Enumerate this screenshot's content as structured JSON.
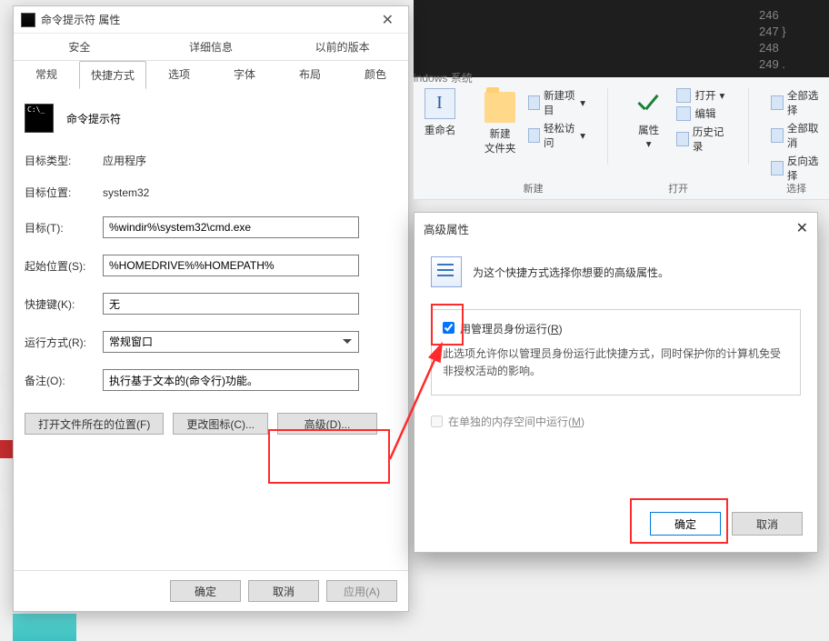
{
  "code_editor": {
    "lines": [
      "246",
      "247  }",
      "248",
      "249  ."
    ]
  },
  "props_dialog": {
    "title": "命令提示符 属性",
    "tabs_top": [
      "安全",
      "详细信息",
      "以前的版本"
    ],
    "tabs_bottom": [
      "常规",
      "快捷方式",
      "选项",
      "字体",
      "布局",
      "颜色"
    ],
    "active_tab": "快捷方式",
    "shortcut_name": "命令提示符",
    "rows": {
      "target_type_label": "目标类型:",
      "target_type_value": "应用程序",
      "target_loc_label": "目标位置:",
      "target_loc_value": "system32",
      "target_label": "目标(T):",
      "target_value": "%windir%\\system32\\cmd.exe",
      "start_in_label": "起始位置(S):",
      "start_in_value": "%HOMEDRIVE%%HOMEPATH%",
      "hotkey_label": "快捷键(K):",
      "hotkey_value": "无",
      "run_label": "运行方式(R):",
      "run_value": "常规窗口",
      "comment_label": "备注(O):",
      "comment_value": "执行基于文本的(命令行)功能。"
    },
    "buttons": {
      "open_location": "打开文件所在的位置(F)",
      "change_icon": "更改图标(C)...",
      "advanced": "高级(D)..."
    },
    "footer": {
      "ok": "确定",
      "cancel": "取消",
      "apply": "应用(A)"
    }
  },
  "ribbon": {
    "header": "indows 系统",
    "rename": "重命名",
    "newfolder_line1": "新建",
    "newfolder_line2": "文件夹",
    "new_item": "新建项目",
    "easy_access": "轻松访问",
    "group_new": "新建",
    "properties": "属性",
    "open": "打开",
    "edit": "编辑",
    "history": "历史记录",
    "group_open": "打开",
    "select_all": "全部选择",
    "select_none": "全部取消",
    "invert": "反向选择",
    "group_select": "选择"
  },
  "adv_dialog": {
    "title": "高级属性",
    "intro": "为这个快捷方式选择你想要的高级属性。",
    "chk_admin_prefix": "用管理员身份运行(",
    "chk_admin_key": "R",
    "chk_admin_suffix": ")",
    "chk_admin_checked": true,
    "desc": "此选项允许你以管理员身份运行此快捷方式，同时保护你的计算机免受非授权活动的影响。",
    "chk_mem_prefix": "在单独的内存空间中运行(",
    "chk_mem_key": "M",
    "chk_mem_suffix": ")",
    "footer": {
      "ok": "确定",
      "cancel": "取消"
    }
  }
}
